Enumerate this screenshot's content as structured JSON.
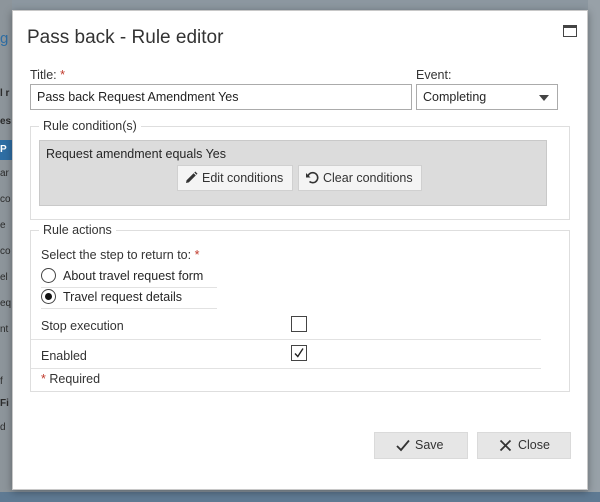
{
  "dialog": {
    "title": "Pass back - Rule editor"
  },
  "form": {
    "title_label": "Title:",
    "required_mark": "*",
    "title_value": "Pass back Request Amendment Yes",
    "event_label": "Event:",
    "event_value": "Completing"
  },
  "conditions": {
    "legend": "Rule condition(s)",
    "summary": "Request amendment equals Yes",
    "edit_label": "Edit conditions",
    "clear_label": "Clear conditions"
  },
  "actions": {
    "legend": "Rule actions",
    "step_label": "Select the step to return to:",
    "options": [
      {
        "label": "About travel request form",
        "selected": false
      },
      {
        "label": "Travel request details",
        "selected": true
      }
    ],
    "stop_label": "Stop execution",
    "stop_checked": false,
    "enabled_label": "Enabled",
    "enabled_checked": true,
    "required_note": "Required"
  },
  "footer": {
    "save_label": "Save",
    "close_label": "Close"
  },
  "background": {
    "fragments": [
      "g",
      "l r",
      "es",
      "P",
      "ar",
      "co",
      "e",
      "co",
      "el",
      "eq",
      "nt",
      "f",
      "Fi",
      "d"
    ]
  },
  "colors": {
    "required": "#c0392b",
    "backdrop": "#8c97a0",
    "condition_box": "#dcdcdc"
  }
}
